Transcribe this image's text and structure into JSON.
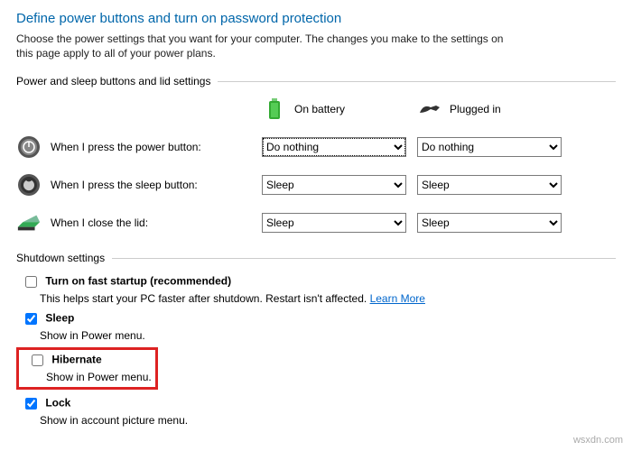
{
  "title": "Define power buttons and turn on password protection",
  "description": "Choose the power settings that you want for your computer. The changes you make to the settings on this page apply to all of your power plans.",
  "section1": "Power and sleep buttons and lid settings",
  "columns": {
    "battery": "On battery",
    "plugged": "Plugged in"
  },
  "rows": {
    "power": {
      "label": "When I press the power button:",
      "battery": "Do nothing",
      "plugged": "Do nothing"
    },
    "sleep": {
      "label": "When I press the sleep button:",
      "battery": "Sleep",
      "plugged": "Sleep"
    },
    "lid": {
      "label": "When I close the lid:",
      "battery": "Sleep",
      "plugged": "Sleep"
    }
  },
  "section2": "Shutdown settings",
  "shutdown": {
    "fast": {
      "label": "Turn on fast startup (recommended)",
      "checked": false,
      "sub": "This helps start your PC faster after shutdown. Restart isn't affected. ",
      "learn": "Learn More"
    },
    "sleep": {
      "label": "Sleep",
      "checked": true,
      "sub": "Show in Power menu."
    },
    "hibernate": {
      "label": "Hibernate",
      "checked": false,
      "sub": "Show in Power menu."
    },
    "lock": {
      "label": "Lock",
      "checked": true,
      "sub": "Show in account picture menu."
    }
  },
  "watermark": "wsxdn.com"
}
